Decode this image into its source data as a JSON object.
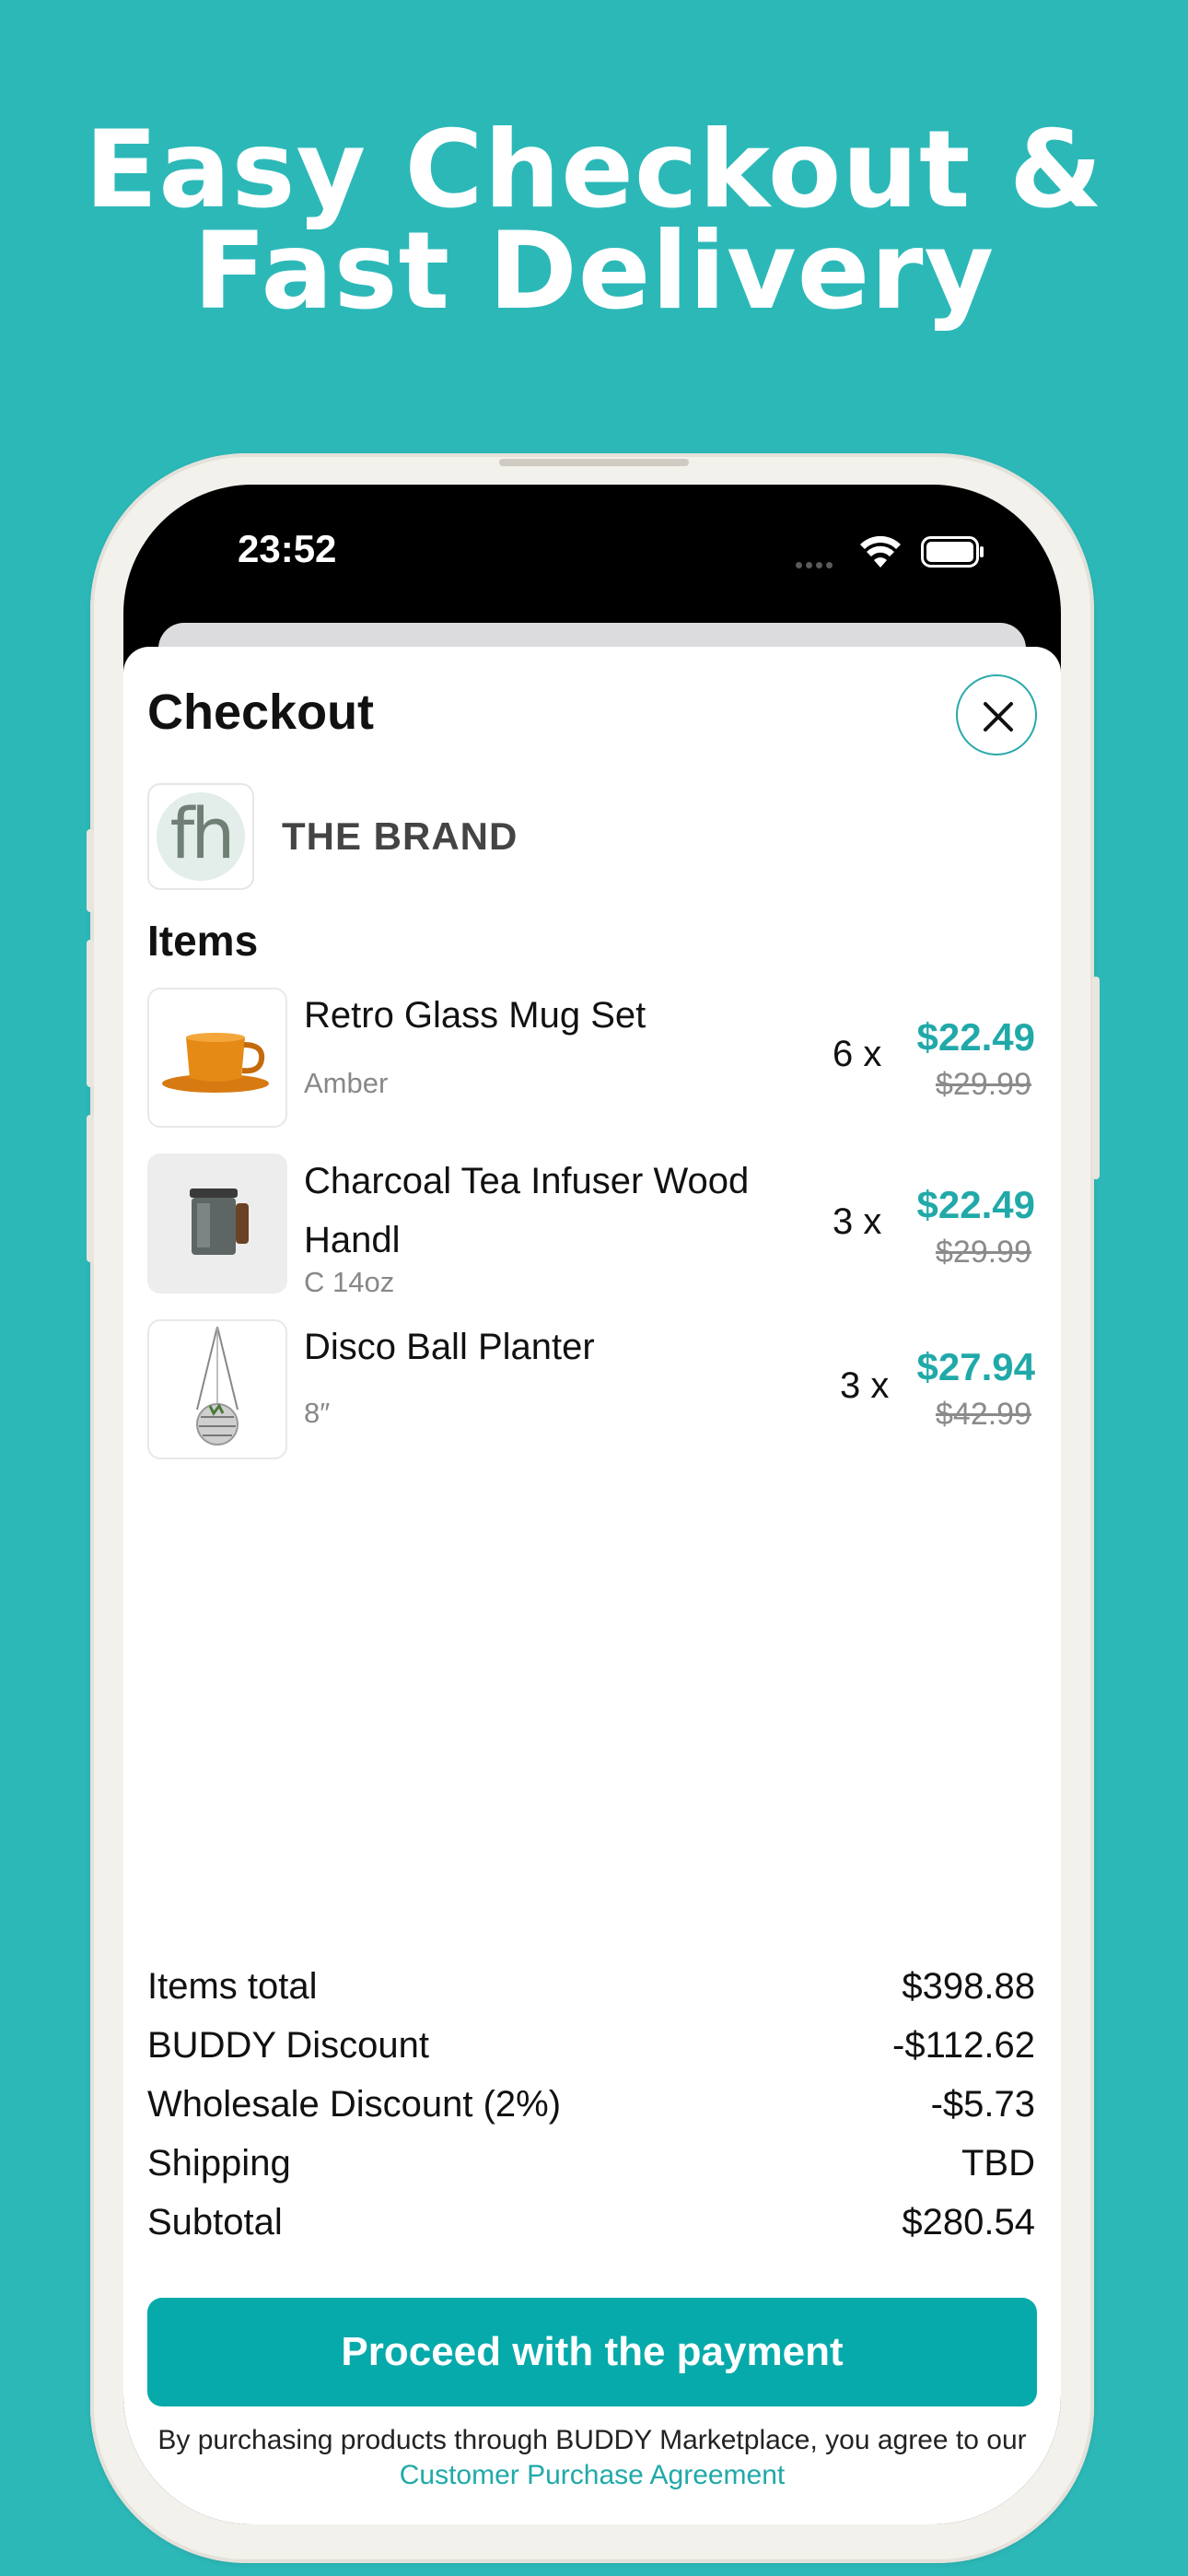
{
  "headline": {
    "line1": "Easy Checkout &",
    "line2": "Fast Delivery"
  },
  "status_bar": {
    "time": "23:52"
  },
  "checkout": {
    "title": "Checkout",
    "brand": {
      "logo_text": "fh",
      "name": "THE BRAND"
    },
    "items_heading": "Items",
    "items": [
      {
        "name": "Retro Glass Mug Set",
        "variant": "Amber",
        "qty": "6 x",
        "price": "$22.49",
        "original_price": "$29.99"
      },
      {
        "name": "Charcoal Tea Infuser Wood Handl",
        "variant": "C 14oz",
        "qty": "3 x",
        "price": "$22.49",
        "original_price": "$29.99"
      },
      {
        "name": "Disco Ball Planter",
        "variant": "8″",
        "qty": "3 x",
        "price": "$27.94",
        "original_price": "$42.99"
      }
    ],
    "totals": [
      {
        "label": "Items total",
        "value": "$398.88"
      },
      {
        "label": "BUDDY Discount",
        "value": "-$112.62"
      },
      {
        "label": "Wholesale Discount (2%)",
        "value": "-$5.73"
      },
      {
        "label": "Shipping",
        "value": "TBD"
      },
      {
        "label": "Subtotal",
        "value": "$280.54"
      }
    ],
    "pay_button": "Proceed with the payment",
    "legal_text": "By purchasing products through BUDDY Marketplace, you agree to our",
    "legal_link": "Customer Purchase Agreement"
  },
  "colors": {
    "background": "#2db8b8",
    "accent": "#21a9a9",
    "button": "#06aaaa"
  }
}
